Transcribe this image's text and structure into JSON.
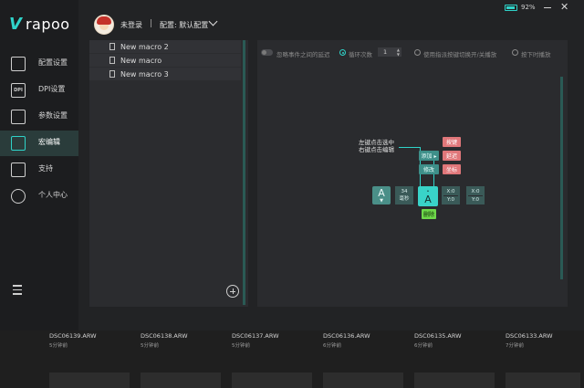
{
  "brand": {
    "mark": "V",
    "word": "rapoo"
  },
  "header": {
    "user": "未登录",
    "profile_label": "配置: 默认配置",
    "battery_pct": "92%",
    "battery_level": 0.92
  },
  "sidebar": {
    "items": [
      {
        "label": "配置设置",
        "icon": "settings-icon"
      },
      {
        "label": "DPI设置",
        "icon": "dpi-icon",
        "icon_text": "DPI"
      },
      {
        "label": "参数设置",
        "icon": "sliders-icon"
      },
      {
        "label": "宏编辑",
        "icon": "macro-icon",
        "active": true
      },
      {
        "label": "支持",
        "icon": "thumbs-up-icon"
      },
      {
        "label": "个人中心",
        "icon": "user-icon"
      }
    ]
  },
  "macros": [
    "New macro 2",
    "New macro",
    "New macro 3"
  ],
  "options": {
    "ignore_delay": "忽略事件之间的延迟",
    "loop_count_label": "循环次数",
    "loop_count": "1",
    "toggle_mode": "使用指派按键切换开/关播放",
    "hold_mode": "按下时播放"
  },
  "editor": {
    "hint_line1": "左键点击选中",
    "hint_line2": "右键点击编辑",
    "menu": {
      "add": "添加 ▸",
      "modify": "修改",
      "key": "按键",
      "delay": "延迟",
      "coordinate": "坐标",
      "delete": "删除"
    },
    "timeline": {
      "key1_letter": "A",
      "key1_arrow": "▼",
      "delay_value": "34",
      "delay_unit": "毫秒",
      "key2_letter": "A",
      "key2_dot": "•",
      "coord1_x": "X:0",
      "coord1_y": "Y:0",
      "coord2_x": "X:0",
      "coord2_y": "Y:0"
    }
  },
  "files": [
    {
      "name": "DSC06139.ARW",
      "age": "5分钟前"
    },
    {
      "name": "DSC06138.ARW",
      "age": "5分钟前"
    },
    {
      "name": "DSC06137.ARW",
      "age": "5分钟前"
    },
    {
      "name": "DSC06136.ARW",
      "age": "6分钟前"
    },
    {
      "name": "DSC06135.ARW",
      "age": "6分钟前"
    },
    {
      "name": "DSC06133.ARW",
      "age": "7分钟前"
    }
  ],
  "colors": {
    "accent": "#2fd3c9",
    "active_bg": "#2a3c3b",
    "red_chip": "#e0777a",
    "green_chip": "#6ed84a"
  }
}
